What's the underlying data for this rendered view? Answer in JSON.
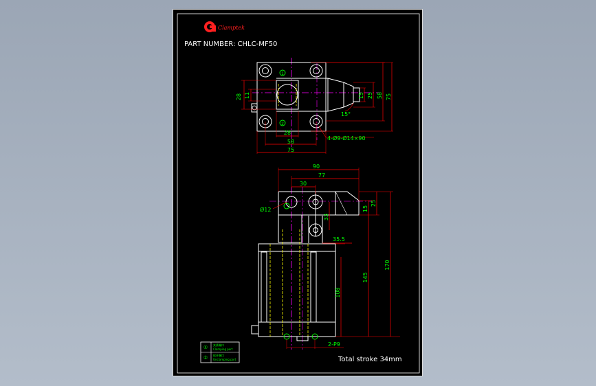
{
  "title_block": {
    "brand": "Clamptek",
    "part_number": "PART NUMBER: CHLC-MF50",
    "total_stroke": "Total stroke 34mm"
  },
  "legend": {
    "items": [
      {
        "symbol": "①",
        "label_cn": "夹紧端口",
        "label_en": "Clamping port"
      },
      {
        "symbol": "②",
        "label_cn": "松开端口",
        "label_en": "Unclamping port"
      }
    ]
  },
  "top_view": {
    "dims": {
      "d28_left": "28",
      "d11": "11",
      "d15": "15",
      "d25": "25",
      "d58_right": "58",
      "d75_right": "75",
      "d28_bottom": "28",
      "d58_bottom": "58",
      "d75_bottom": "75",
      "angle": "15°",
      "holes": "4-Ø9-Ø14×90"
    },
    "port_labels": [
      "1",
      "2"
    ]
  },
  "front_view": {
    "dims": {
      "d90": "90",
      "d77": "77",
      "d30": "30",
      "d25": "25",
      "d15": "15",
      "d33": "33",
      "d35_5": "35.5",
      "d12": "Ø12",
      "d108": "108",
      "d145": "145",
      "d170": "170",
      "ports": "2-P9"
    }
  },
  "colors": {
    "sheet": "#000000",
    "outline": "#ffffff",
    "dimension": "#ff0000",
    "text": "#00ff00",
    "centerline": "#ff00ff",
    "hidden": "#ffff00",
    "port": "#00ff00"
  }
}
